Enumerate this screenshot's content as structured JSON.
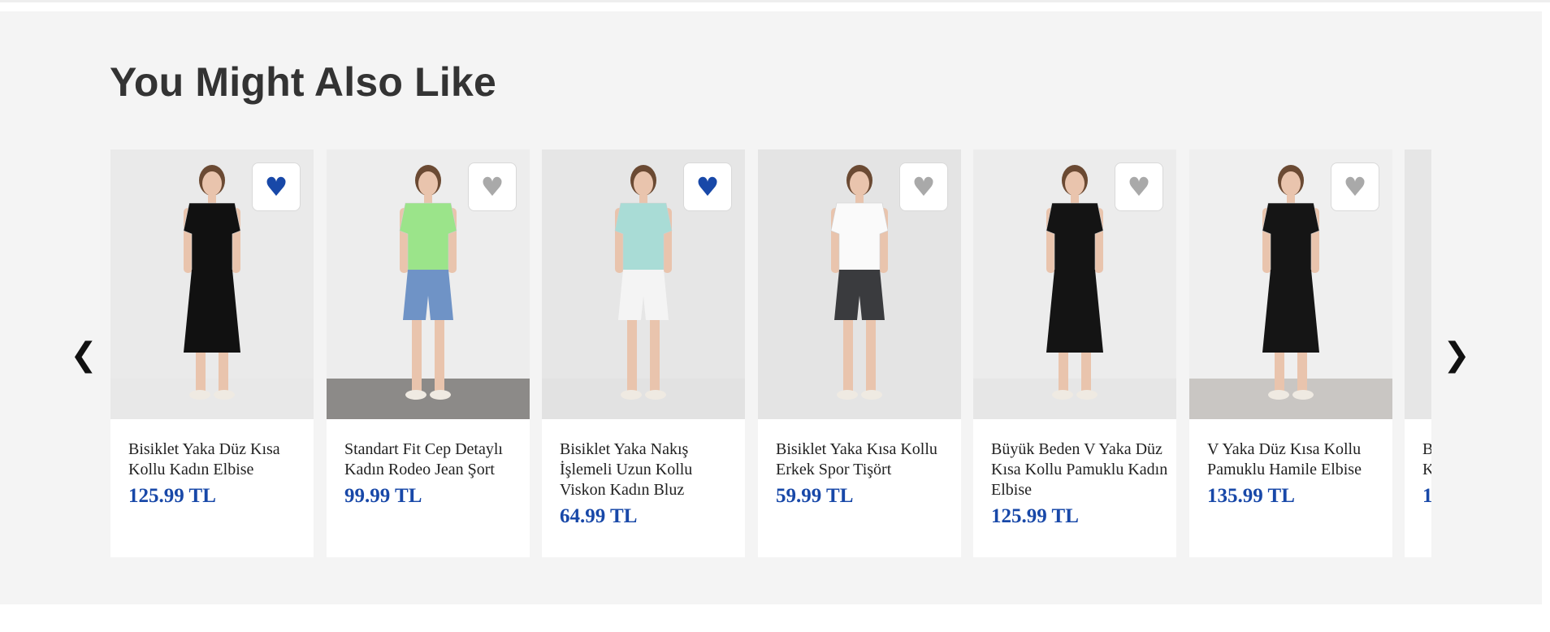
{
  "section": {
    "title": "You Might Also Like"
  },
  "nav": {
    "prev_label": "❮",
    "next_label": "❯"
  },
  "colors": {
    "price": "#1848a8",
    "fav_active": "#1848a8",
    "fav_inactive": "#a9a9a9",
    "background": "#f4f4f4"
  },
  "products": [
    {
      "name": "Bisiklet Yaka Düz Kısa Kollu Kadın Elbise",
      "price": "125.99 TL",
      "favorited": true,
      "outfit": "black dress",
      "image_bg": "#eaeaea",
      "top_color": "#111111",
      "bottom_color": "#111111",
      "floor": "#e8e8e8"
    },
    {
      "name": "Standart Fit Cep Detaylı Kadın Rodeo Jean Şort",
      "price": "99.99 TL",
      "favorited": false,
      "outfit": "green shirt, denim shorts",
      "image_bg": "#ededed",
      "top_color": "#9be48a",
      "bottom_color": "#6f93c6",
      "floor": "#8c8a88"
    },
    {
      "name": "Bisiklet Yaka Nakış İşlemeli Uzun Kollu Viskon Kadın Bluz",
      "price": "64.99 TL",
      "favorited": true,
      "outfit": "floral blouse, white trousers",
      "image_bg": "#e6e6e6",
      "top_color": "#a9dcd6",
      "bottom_color": "#f4f4f4",
      "floor": "#e2e2e2"
    },
    {
      "name": "Bisiklet Yaka Kısa Kollu Erkek Spor Tişört",
      "price": "59.99 TL",
      "favorited": false,
      "outfit": "white t-shirt, grey shorts",
      "image_bg": "#e4e4e4",
      "top_color": "#fafafa",
      "bottom_color": "#3a3b3e",
      "floor": "#e4e4e4"
    },
    {
      "name": "Büyük Beden V Yaka Düz Kısa Kollu Pamuklu Kadın Elbise",
      "price": "125.99 TL",
      "favorited": false,
      "outfit": "black long dress",
      "image_bg": "#ececec",
      "top_color": "#141414",
      "bottom_color": "#141414",
      "floor": "#e6e6e6"
    },
    {
      "name": "V Yaka Düz Kısa Kollu Pamuklu Hamile Elbise",
      "price": "135.99 TL",
      "favorited": false,
      "outfit": "black maternity dress",
      "image_bg": "#efefef",
      "top_color": "#151515",
      "bottom_color": "#151515",
      "floor": "#c9c6c3"
    },
    {
      "name": "B\nK",
      "price": "1",
      "favorited": false,
      "outfit": "partially visible",
      "image_bg": "#e6e6e6",
      "top_color": "#e6e6e6",
      "bottom_color": "#e6e6e6",
      "floor": "#e6e6e6"
    }
  ]
}
